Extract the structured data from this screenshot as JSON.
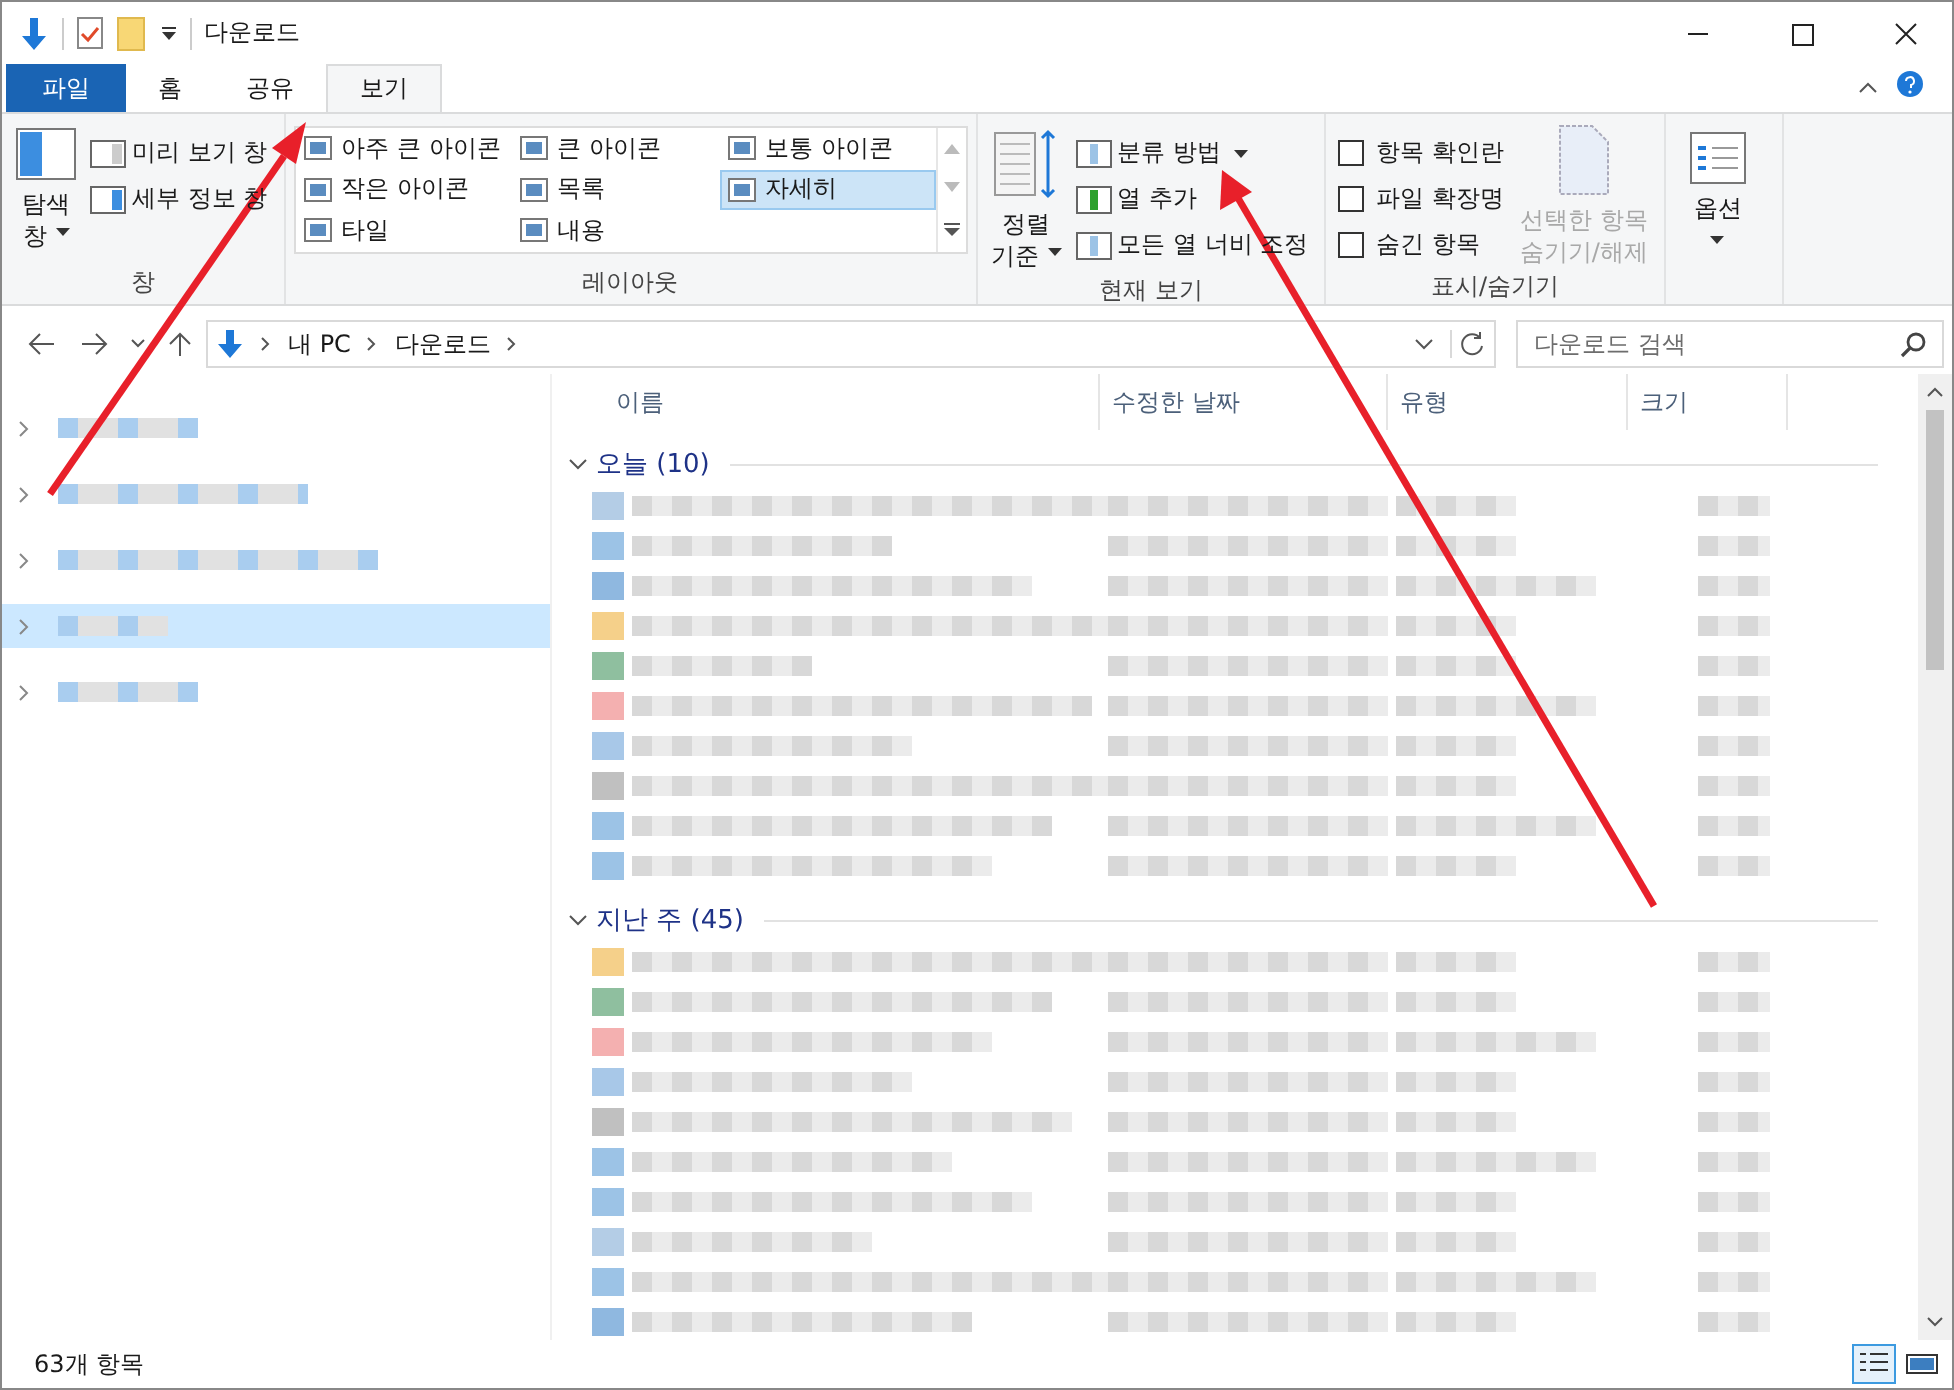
{
  "window": {
    "title": "다운로드"
  },
  "tabs": [
    {
      "label": "파일",
      "kind": "file",
      "selected": false
    },
    {
      "label": "홈",
      "kind": "tab",
      "selected": false
    },
    {
      "label": "공유",
      "kind": "tab",
      "selected": false
    },
    {
      "label": "보기",
      "kind": "tab",
      "selected": true
    }
  ],
  "ribbon": {
    "panes": {
      "nav_button": "탐색",
      "nav_button_line2": "창",
      "items": [
        "미리 보기 창",
        "세부 정보 창"
      ],
      "label": "창"
    },
    "layout": {
      "options": [
        {
          "label": "아주 큰 아이콘",
          "selected": false
        },
        {
          "label": "큰 아이콘",
          "selected": false
        },
        {
          "label": "보통 아이콘",
          "selected": false
        },
        {
          "label": "작은 아이콘",
          "selected": false
        },
        {
          "label": "목록",
          "selected": false
        },
        {
          "label": "자세히",
          "selected": true
        },
        {
          "label": "타일",
          "selected": false
        },
        {
          "label": "내용",
          "selected": false
        }
      ],
      "label": "레이아웃"
    },
    "current_view": {
      "sort_button": "정렬",
      "sort_button_line2": "기준",
      "items": [
        "분류 방법",
        "열 추가",
        "모든 열 너비 조정"
      ],
      "label": "현재 보기"
    },
    "show_hide": {
      "checkboxes": [
        {
          "label": "항목 확인란",
          "checked": false
        },
        {
          "label": "파일 확장명",
          "checked": false
        },
        {
          "label": "숨긴 항목",
          "checked": false
        }
      ],
      "hide_button": {
        "line1": "선택한 항목",
        "line2": "숨기기/해제",
        "disabled": true
      },
      "label": "표시/숨기기"
    },
    "options_button": "옵션"
  },
  "address": {
    "path": [
      "내 PC",
      "다운로드"
    ],
    "search_placeholder": "다운로드 검색"
  },
  "sidebar": {
    "items": [
      {
        "selected": false
      },
      {
        "selected": false
      },
      {
        "selected": false
      },
      {
        "selected": true
      },
      {
        "selected": false
      }
    ]
  },
  "columns": [
    "이름",
    "수정한 날짜",
    "유형",
    "크기"
  ],
  "groups": [
    {
      "label": "오늘 (10)",
      "expanded": true
    },
    {
      "label": "지난 주 (45)",
      "expanded": true
    }
  ],
  "status_bar": {
    "item_count": "63개 항목",
    "views": [
      {
        "selected": true
      },
      {
        "selected": false
      }
    ]
  }
}
